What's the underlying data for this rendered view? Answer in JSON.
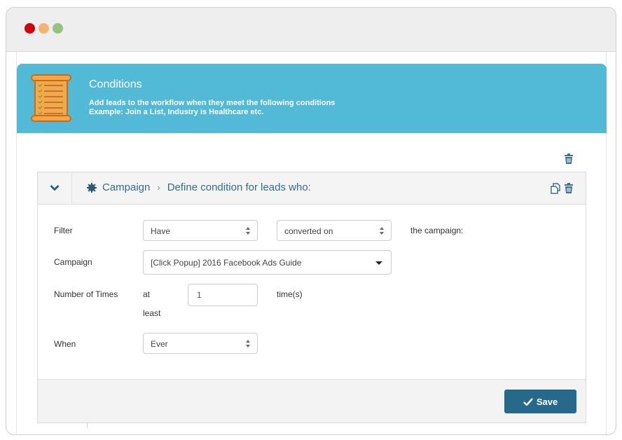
{
  "window": {
    "traffic_lights": [
      "close",
      "minimize",
      "maximize"
    ],
    "colors": {
      "close": "#d0020c",
      "minimize": "#f6b26f",
      "maximize": "#93c47d"
    }
  },
  "banner": {
    "icon": "checklist-scroll-icon",
    "title": "Conditions",
    "description_line1": "Add leads to the workflow when they meet the following conditions",
    "description_line2": "Example: Join a List, Industry is Healthcare etc.",
    "color": "#52b9d7"
  },
  "actions": {
    "delete_all_icon": "trash-icon"
  },
  "condition": {
    "collapse_icon": "chevron-down-icon",
    "type_icon": "gear-icon",
    "type": "Campaign",
    "separator": "›",
    "heading": "Define condition for leads who:",
    "header_icons": [
      "copy-icon",
      "trash-icon"
    ],
    "rows": {
      "filter": {
        "label": "Filter",
        "select1_value": "Have",
        "select2_value": "converted on",
        "suffix": "the campaign:"
      },
      "campaign": {
        "label": "Campaign",
        "value": "[Click Popup] 2016 Facebook Ads Guide"
      },
      "times": {
        "label": "Number of Times",
        "prefix_line1": "at",
        "prefix_line2": "least",
        "value": "1",
        "suffix": "time(s)"
      },
      "when": {
        "label": "When",
        "value": "Ever"
      }
    },
    "footer": {
      "save_label": "Save",
      "save_icon": "checkmark-icon",
      "save_color": "#27698a"
    }
  }
}
